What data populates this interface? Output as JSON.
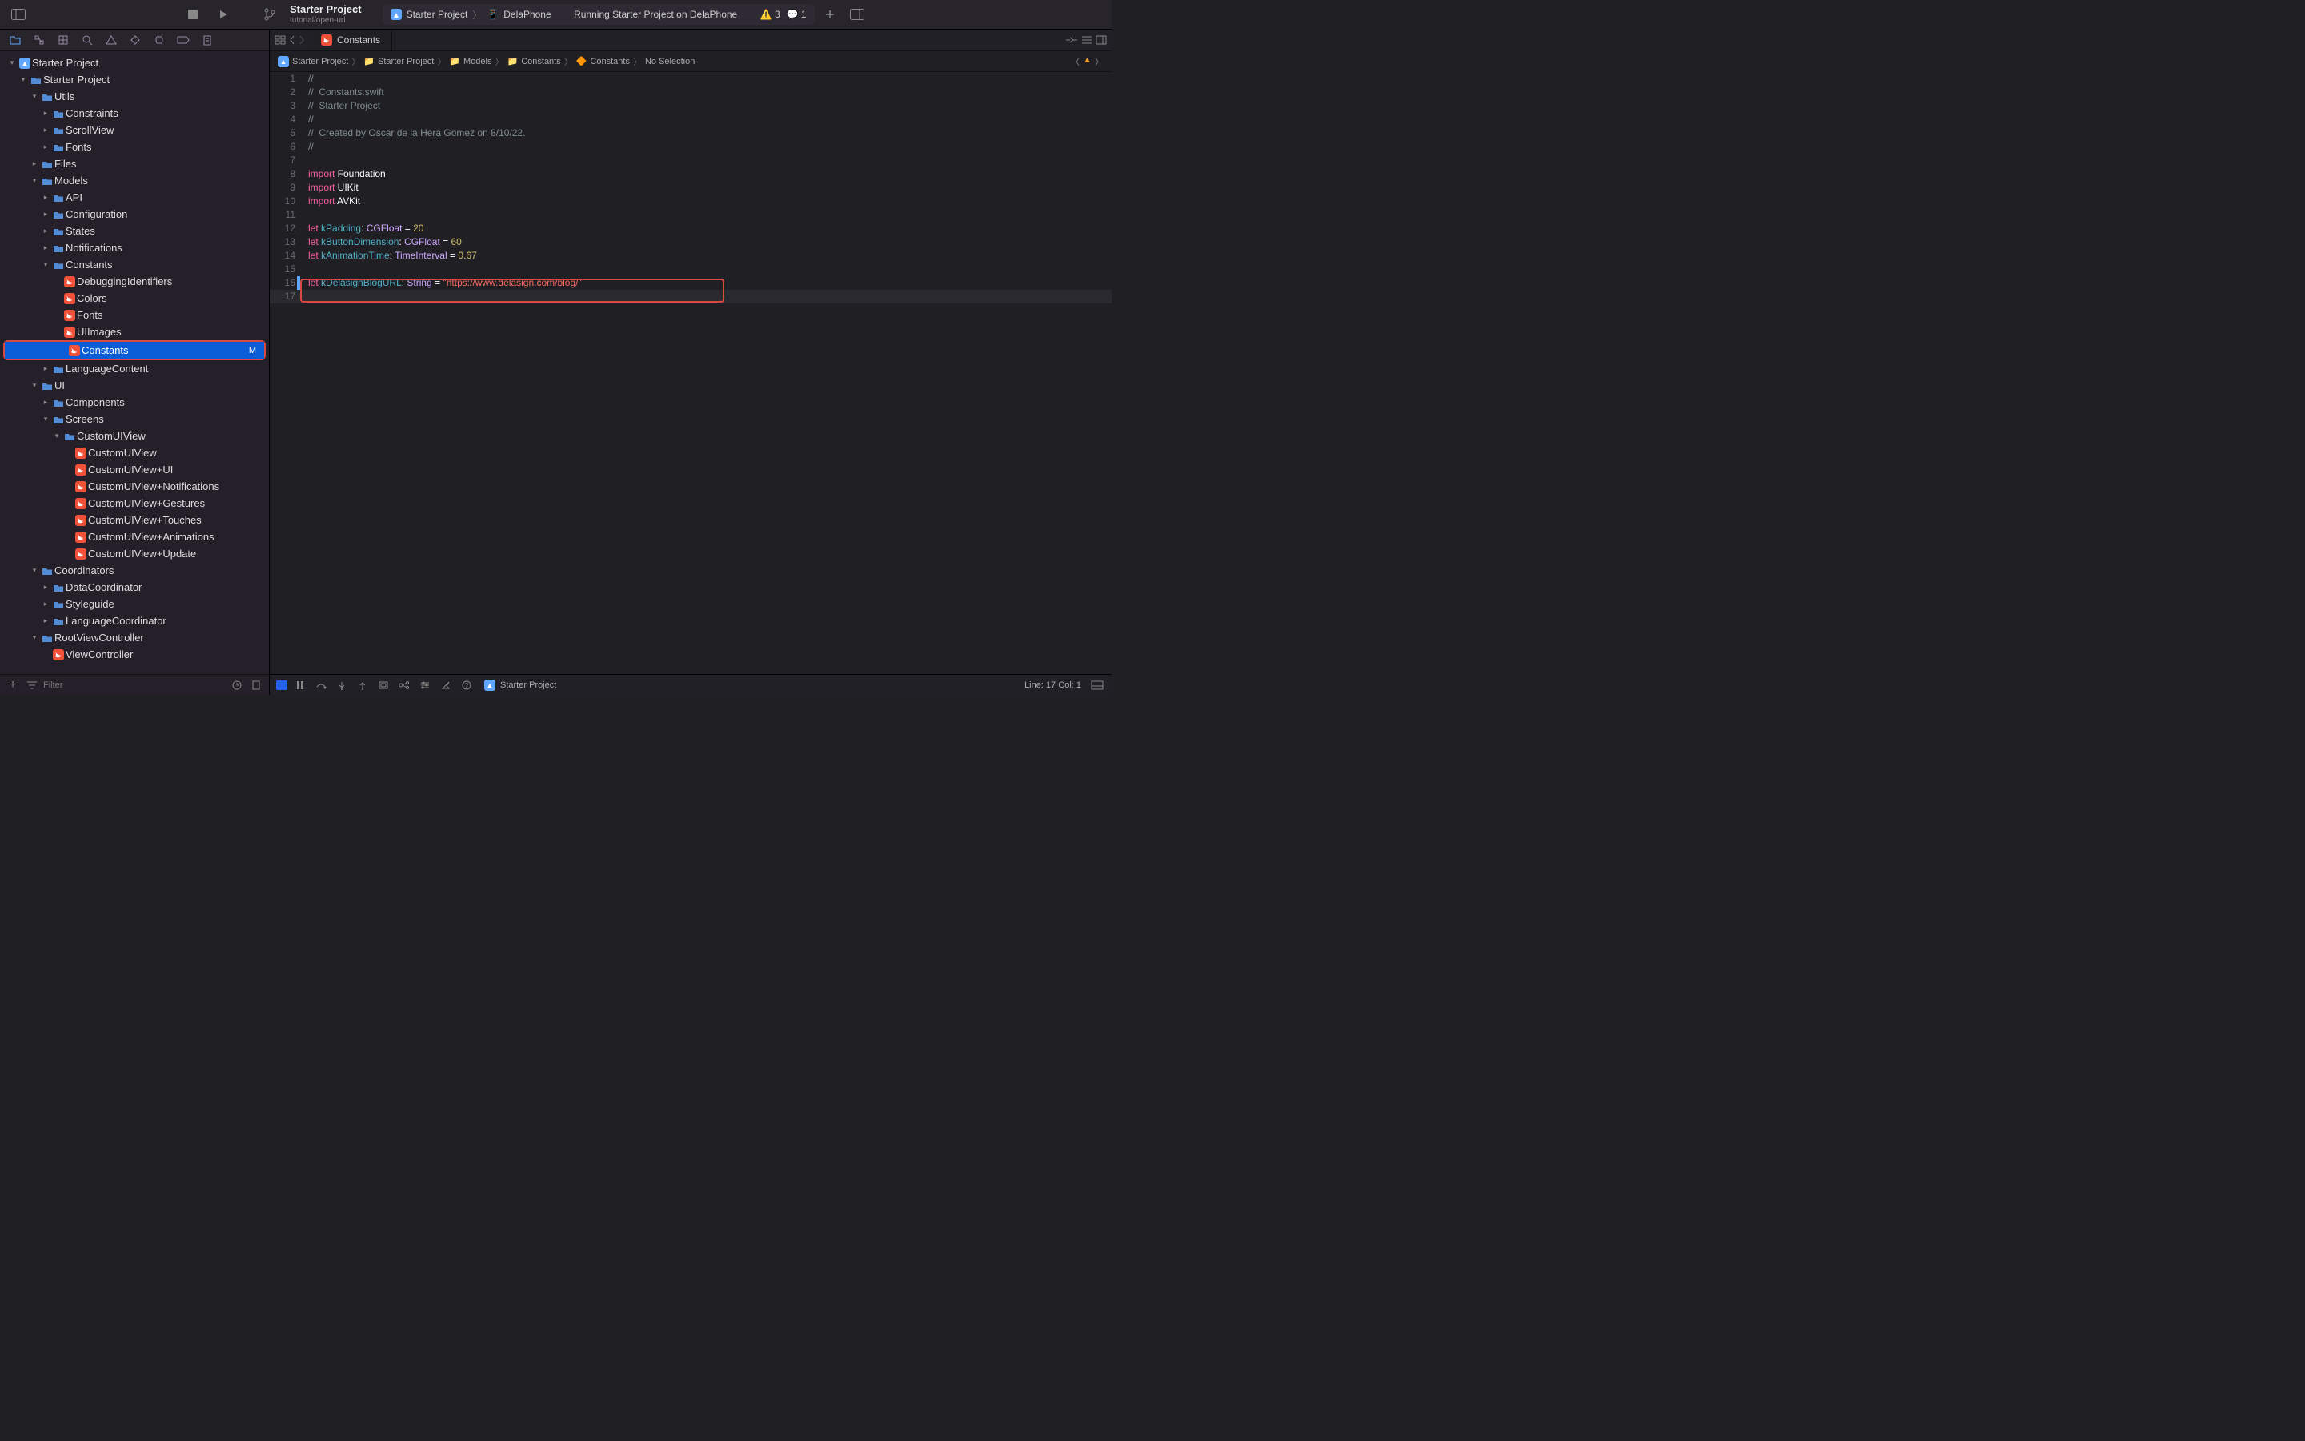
{
  "toolbar": {
    "project_name": "Starter Project",
    "project_sub": "tutorial/open-url",
    "scheme_app": "Starter Project",
    "scheme_device": "DelaPhone",
    "status_text": "Running Starter Project on DelaPhone",
    "warn_count": "3",
    "msg_count": "1"
  },
  "tabbar": {
    "active_tab": "Constants"
  },
  "breadcrumb": {
    "items": [
      "Starter Project",
      "Starter Project",
      "Models",
      "Constants",
      "Constants",
      "No Selection"
    ]
  },
  "sidebar": {
    "filter_placeholder": "Filter"
  },
  "tree": {
    "root": "Starter Project",
    "items": [
      {
        "indent": 0,
        "chev": "v",
        "type": "proj",
        "label": "Starter Project"
      },
      {
        "indent": 1,
        "chev": "v",
        "type": "folder",
        "label": "Starter Project"
      },
      {
        "indent": 2,
        "chev": "v",
        "type": "folder",
        "label": "Utils"
      },
      {
        "indent": 3,
        "chev": ">",
        "type": "folder",
        "label": "Constraints"
      },
      {
        "indent": 3,
        "chev": ">",
        "type": "folder",
        "label": "ScrollView"
      },
      {
        "indent": 3,
        "chev": ">",
        "type": "folder",
        "label": "Fonts"
      },
      {
        "indent": 2,
        "chev": ">",
        "type": "folder",
        "label": "Files"
      },
      {
        "indent": 2,
        "chev": "v",
        "type": "folder",
        "label": "Models"
      },
      {
        "indent": 3,
        "chev": ">",
        "type": "folder",
        "label": "API"
      },
      {
        "indent": 3,
        "chev": ">",
        "type": "folder",
        "label": "Configuration"
      },
      {
        "indent": 3,
        "chev": ">",
        "type": "folder",
        "label": "States"
      },
      {
        "indent": 3,
        "chev": ">",
        "type": "folder",
        "label": "Notifications"
      },
      {
        "indent": 3,
        "chev": "v",
        "type": "folder",
        "label": "Constants"
      },
      {
        "indent": 4,
        "chev": "",
        "type": "swift",
        "label": "DebuggingIdentifiers"
      },
      {
        "indent": 4,
        "chev": "",
        "type": "swift",
        "label": "Colors"
      },
      {
        "indent": 4,
        "chev": "",
        "type": "swift",
        "label": "Fonts"
      },
      {
        "indent": 4,
        "chev": "",
        "type": "swift",
        "label": "UIImages"
      },
      {
        "indent": 4,
        "chev": "",
        "type": "swift",
        "label": "Constants",
        "selected": true,
        "badge": "M",
        "highlighted": true
      },
      {
        "indent": 3,
        "chev": ">",
        "type": "folder",
        "label": "LanguageContent"
      },
      {
        "indent": 2,
        "chev": "v",
        "type": "folder",
        "label": "UI"
      },
      {
        "indent": 3,
        "chev": ">",
        "type": "folder",
        "label": "Components"
      },
      {
        "indent": 3,
        "chev": "v",
        "type": "folder",
        "label": "Screens"
      },
      {
        "indent": 4,
        "chev": "v",
        "type": "folder",
        "label": "CustomUIView"
      },
      {
        "indent": 5,
        "chev": "",
        "type": "swift",
        "label": "CustomUIView"
      },
      {
        "indent": 5,
        "chev": "",
        "type": "swift",
        "label": "CustomUIView+UI"
      },
      {
        "indent": 5,
        "chev": "",
        "type": "swift",
        "label": "CustomUIView+Notifications"
      },
      {
        "indent": 5,
        "chev": "",
        "type": "swift",
        "label": "CustomUIView+Gestures"
      },
      {
        "indent": 5,
        "chev": "",
        "type": "swift",
        "label": "CustomUIView+Touches"
      },
      {
        "indent": 5,
        "chev": "",
        "type": "swift",
        "label": "CustomUIView+Animations"
      },
      {
        "indent": 5,
        "chev": "",
        "type": "swift",
        "label": "CustomUIView+Update"
      },
      {
        "indent": 2,
        "chev": "v",
        "type": "folder",
        "label": "Coordinators"
      },
      {
        "indent": 3,
        "chev": ">",
        "type": "folder",
        "label": "DataCoordinator"
      },
      {
        "indent": 3,
        "chev": ">",
        "type": "folder",
        "label": "Styleguide"
      },
      {
        "indent": 3,
        "chev": ">",
        "type": "folder",
        "label": "LanguageCoordinator"
      },
      {
        "indent": 2,
        "chev": "v",
        "type": "folder",
        "label": "RootViewController"
      },
      {
        "indent": 3,
        "chev": "",
        "type": "swift",
        "label": "ViewController"
      }
    ]
  },
  "code": {
    "lines": [
      {
        "n": 1,
        "seg": [
          {
            "c": "k-comment",
            "t": "//"
          }
        ]
      },
      {
        "n": 2,
        "seg": [
          {
            "c": "k-comment",
            "t": "//  Constants.swift"
          }
        ]
      },
      {
        "n": 3,
        "seg": [
          {
            "c": "k-comment",
            "t": "//  Starter Project"
          }
        ]
      },
      {
        "n": 4,
        "seg": [
          {
            "c": "k-comment",
            "t": "//"
          }
        ]
      },
      {
        "n": 5,
        "seg": [
          {
            "c": "k-comment",
            "t": "//  Created by Oscar de la Hera Gomez on 8/10/22."
          }
        ]
      },
      {
        "n": 6,
        "seg": [
          {
            "c": "k-comment",
            "t": "//"
          }
        ]
      },
      {
        "n": 7,
        "seg": []
      },
      {
        "n": 8,
        "seg": [
          {
            "c": "k-keyword",
            "t": "import"
          },
          {
            "c": "k-plain",
            "t": " Foundation"
          }
        ]
      },
      {
        "n": 9,
        "seg": [
          {
            "c": "k-keyword",
            "t": "import"
          },
          {
            "c": "k-plain",
            "t": " UIKit"
          }
        ]
      },
      {
        "n": 10,
        "seg": [
          {
            "c": "k-keyword",
            "t": "import"
          },
          {
            "c": "k-plain",
            "t": " AVKit"
          }
        ]
      },
      {
        "n": 11,
        "seg": []
      },
      {
        "n": 12,
        "seg": [
          {
            "c": "k-keyword",
            "t": "let"
          },
          {
            "c": "k-plain",
            "t": " "
          },
          {
            "c": "k-ident",
            "t": "kPadding"
          },
          {
            "c": "k-plain",
            "t": ": "
          },
          {
            "c": "k-type",
            "t": "CGFloat"
          },
          {
            "c": "k-plain",
            "t": " = "
          },
          {
            "c": "k-num",
            "t": "20"
          }
        ]
      },
      {
        "n": 13,
        "seg": [
          {
            "c": "k-keyword",
            "t": "let"
          },
          {
            "c": "k-plain",
            "t": " "
          },
          {
            "c": "k-ident",
            "t": "kButtonDimension"
          },
          {
            "c": "k-plain",
            "t": ": "
          },
          {
            "c": "k-type",
            "t": "CGFloat"
          },
          {
            "c": "k-plain",
            "t": " = "
          },
          {
            "c": "k-num",
            "t": "60"
          }
        ]
      },
      {
        "n": 14,
        "seg": [
          {
            "c": "k-keyword",
            "t": "let"
          },
          {
            "c": "k-plain",
            "t": " "
          },
          {
            "c": "k-ident",
            "t": "kAnimationTime"
          },
          {
            "c": "k-plain",
            "t": ": "
          },
          {
            "c": "k-type",
            "t": "TimeInterval"
          },
          {
            "c": "k-plain",
            "t": " = "
          },
          {
            "c": "k-num",
            "t": "0.67"
          }
        ]
      },
      {
        "n": 15,
        "seg": []
      },
      {
        "n": 16,
        "mark": true,
        "box": true,
        "seg": [
          {
            "c": "k-keyword",
            "t": "let"
          },
          {
            "c": "k-plain",
            "t": " "
          },
          {
            "c": "k-ident",
            "t": "kDelasignBlogURL"
          },
          {
            "c": "k-plain",
            "t": ": "
          },
          {
            "c": "k-type",
            "t": "String"
          },
          {
            "c": "k-plain",
            "t": " = "
          },
          {
            "c": "k-string",
            "t": "\"https://www.delasign.com/blog/\""
          }
        ]
      },
      {
        "n": 17,
        "cursor": true,
        "seg": []
      }
    ]
  },
  "debug": {
    "target": "Starter Project",
    "line_col": "Line: 17  Col: 1"
  }
}
